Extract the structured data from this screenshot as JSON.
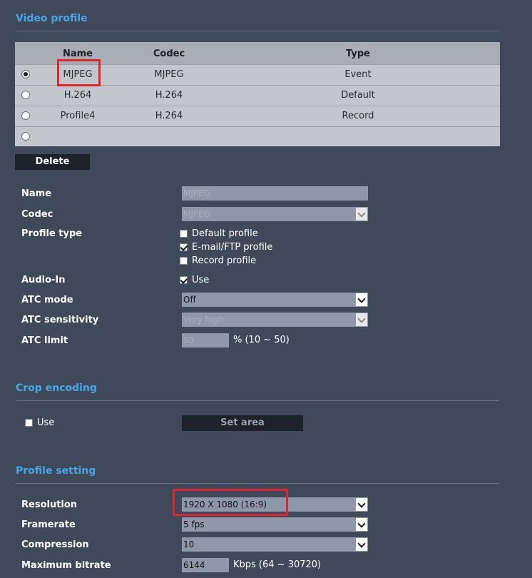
{
  "video_profile": {
    "title": "Video profile",
    "columns": [
      "Name",
      "Codec",
      "Type"
    ],
    "rows": [
      {
        "name": "MJPEG",
        "codec": "MJPEG",
        "type": "Event",
        "selected": true
      },
      {
        "name": "H.264",
        "codec": "H.264",
        "type": "Default",
        "selected": false
      },
      {
        "name": "Profile4",
        "codec": "H.264",
        "type": "Record",
        "selected": false
      },
      {
        "name": "",
        "codec": "",
        "type": "",
        "selected": false
      }
    ],
    "delete_label": "Delete"
  },
  "form": {
    "name_label": "Name",
    "name_value": "MJPEG",
    "codec_label": "Codec",
    "codec_value": "MJPEG",
    "profile_type_label": "Profile type",
    "profile_types": [
      {
        "label": "Default profile",
        "checked": false
      },
      {
        "label": "E-mail/FTP profile",
        "checked": true
      },
      {
        "label": "Record profile",
        "checked": false
      }
    ],
    "audio_in_label": "Audio-In",
    "audio_in_option": "Use",
    "audio_in_checked": true,
    "atc_mode_label": "ATC mode",
    "atc_mode_value": "Off",
    "atc_sensitivity_label": "ATC sensitivity",
    "atc_sensitivity_value": "Very high",
    "atc_limit_label": "ATC limit",
    "atc_limit_value": "50",
    "atc_limit_range": "% (10 ~ 50)"
  },
  "crop_encoding": {
    "title": "Crop encoding",
    "use_label": "Use",
    "use_checked": false,
    "set_area_label": "Set area"
  },
  "profile_setting": {
    "title": "Profile setting",
    "resolution_label": "Resolution",
    "resolution_value": "1920 X 1080 (16:9)",
    "framerate_label": "Framerate",
    "framerate_value": "5 fps",
    "compression_label": "Compression",
    "compression_value": "10",
    "max_bitrate_label": "Maximum bitrate",
    "max_bitrate_value": "6144",
    "max_bitrate_range": "Kbps (64 ~ 30720)"
  },
  "colors": {
    "background": "#404959",
    "section_title": "#46a6e8",
    "highlight": "#e0262c"
  }
}
